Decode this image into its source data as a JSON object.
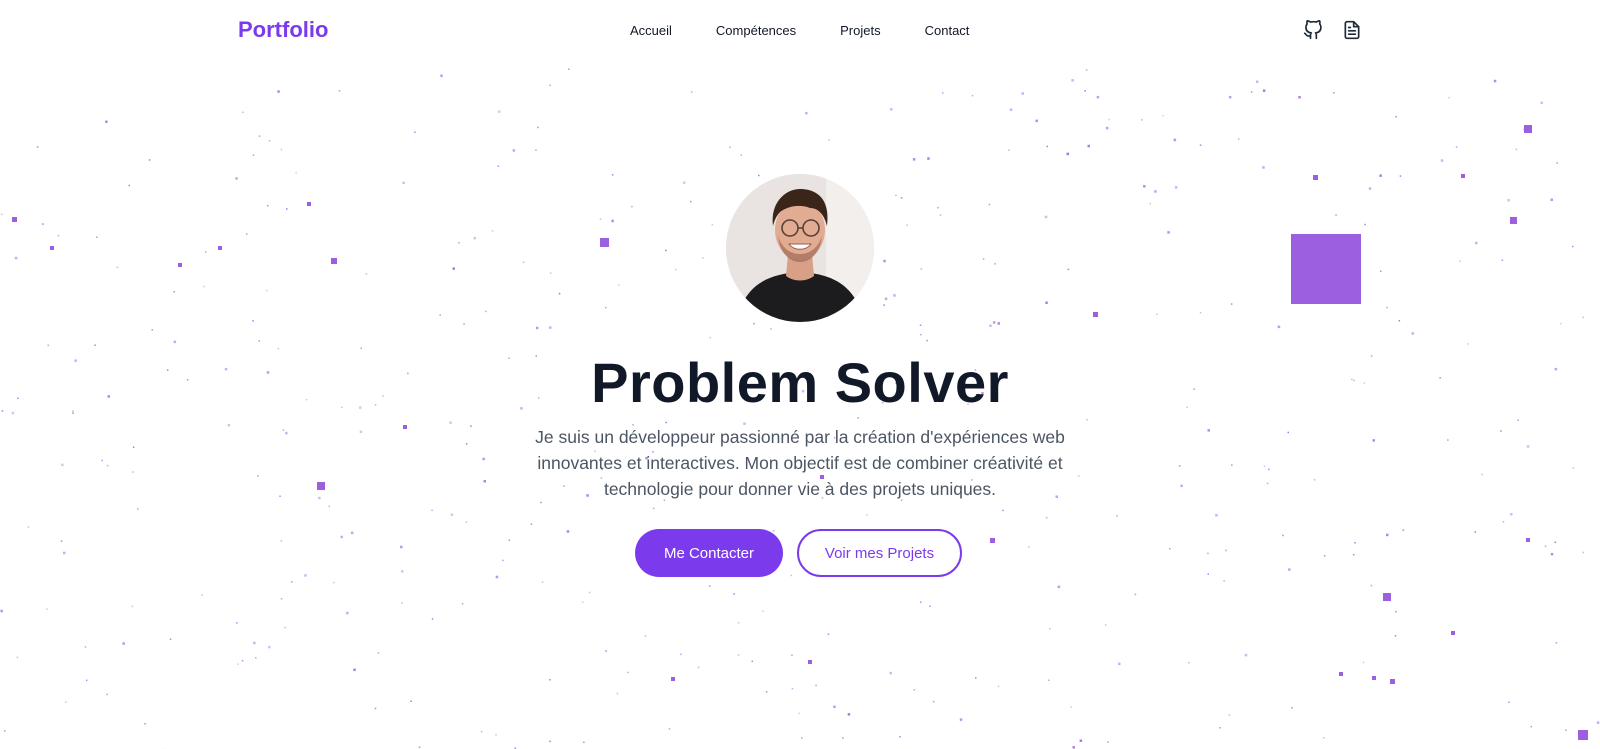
{
  "nav": {
    "logo": "Portfolio",
    "links": [
      "Accueil",
      "Compétences",
      "Projets",
      "Contact"
    ],
    "icons": [
      "github-icon",
      "document-icon"
    ]
  },
  "hero": {
    "title": "Problem Solver",
    "description": "Je suis un développeur passionné par la création d'expériences web innovantes et interactives. Mon objectif est de combiner créativité et technologie pour donner vie à des projets uniques.",
    "primary_button": "Me Contacter",
    "secondary_button": "Voir mes Projets"
  },
  "colors": {
    "accent": "#7c3aed",
    "particle": "#9b5fe0",
    "title": "#111827",
    "text": "#4b5563"
  }
}
